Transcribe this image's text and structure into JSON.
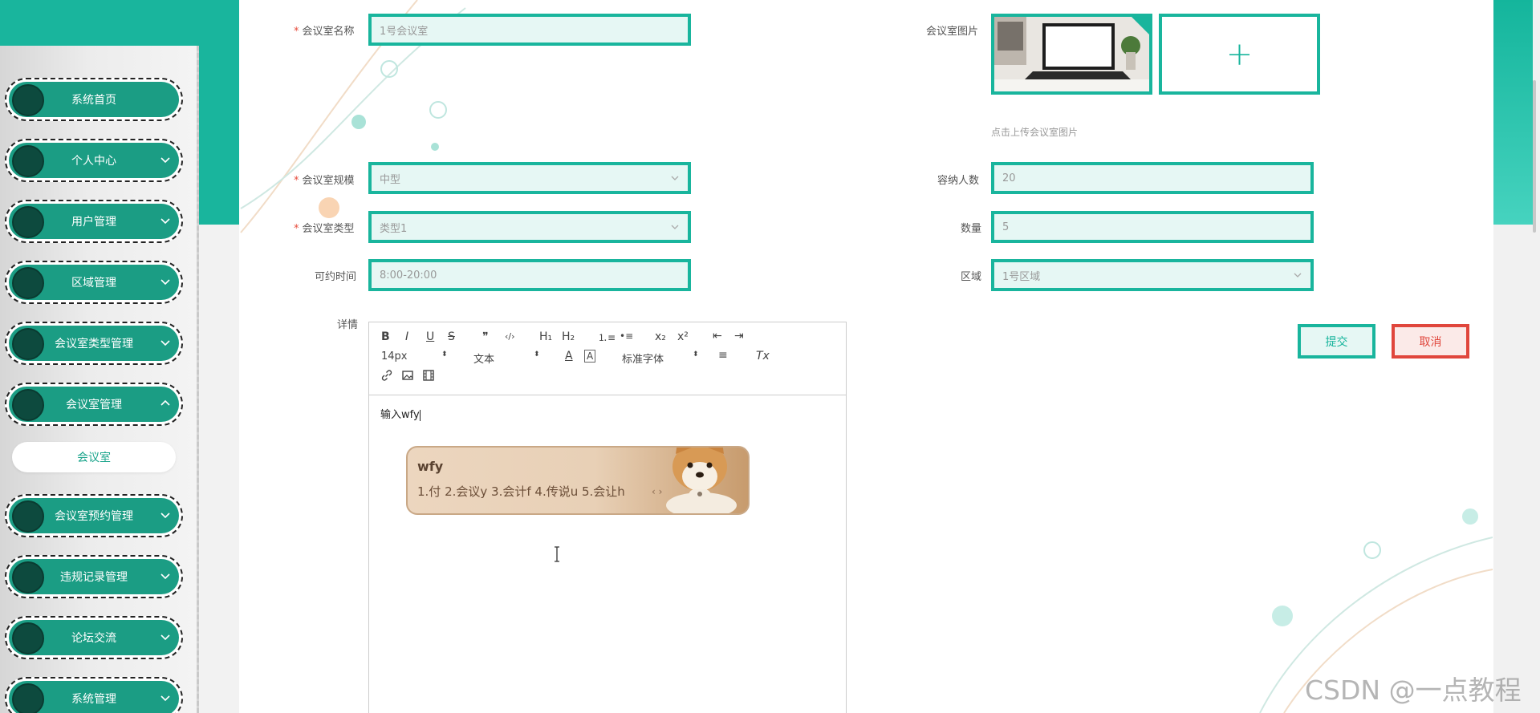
{
  "sidebar": {
    "items": [
      {
        "label": "系统首页",
        "expandable": false
      },
      {
        "label": "个人中心",
        "expandable": true
      },
      {
        "label": "用户管理",
        "expandable": true
      },
      {
        "label": "区域管理",
        "expandable": true
      },
      {
        "label": "会议室类型管理",
        "expandable": true
      },
      {
        "label": "会议室管理",
        "expandable": true,
        "expanded": true
      },
      {
        "label": "会议室预约管理",
        "expandable": true
      },
      {
        "label": "违规记录管理",
        "expandable": true
      },
      {
        "label": "论坛交流",
        "expandable": true
      },
      {
        "label": "系统管理",
        "expandable": true
      }
    ],
    "active_sub_item": "会议室"
  },
  "form": {
    "required_mark": "*",
    "name": {
      "label": "会议室名称",
      "value": "1号会议室"
    },
    "image": {
      "label": "会议室图片",
      "hint": "点击上传会议室图片",
      "add_symbol": "+"
    },
    "scale": {
      "label": "会议室规模",
      "value": "中型"
    },
    "capacity": {
      "label": "容纳人数",
      "value": "20"
    },
    "type": {
      "label": "会议室类型",
      "value": "类型1"
    },
    "quantity": {
      "label": "数量",
      "value": "5"
    },
    "available_time": {
      "label": "可约时间",
      "value": "8:00-20:00"
    },
    "area": {
      "label": "区域",
      "value": "1号区域"
    },
    "detail": {
      "label": "详情"
    }
  },
  "editor": {
    "toolbar": {
      "bold": "B",
      "italic": "I",
      "underline": "U",
      "strike": "S",
      "quote": "❞",
      "code": "‹/›",
      "h1": "H₁",
      "h2": "H₂",
      "ordered_list": "⒈≡",
      "bullet_list": "•≡",
      "subscript": "x₂",
      "superscript": "x²",
      "outdent": "⇤",
      "indent": "⇥",
      "size_value": "14px",
      "header_value": "文本",
      "font_value": "标准字体",
      "clear": "Tx"
    },
    "content": "输入wfy"
  },
  "ime": {
    "code": "wfy",
    "candidates": "1.付  2.会议y  3.会计f  4.传说u  5.会让h"
  },
  "buttons": {
    "submit": "提交",
    "cancel": "取消"
  },
  "watermark": "CSDN @一点教程",
  "colors": {
    "accent": "#19b59d",
    "danger": "#e0463c",
    "sidebar_pill": "#1b9d84"
  }
}
